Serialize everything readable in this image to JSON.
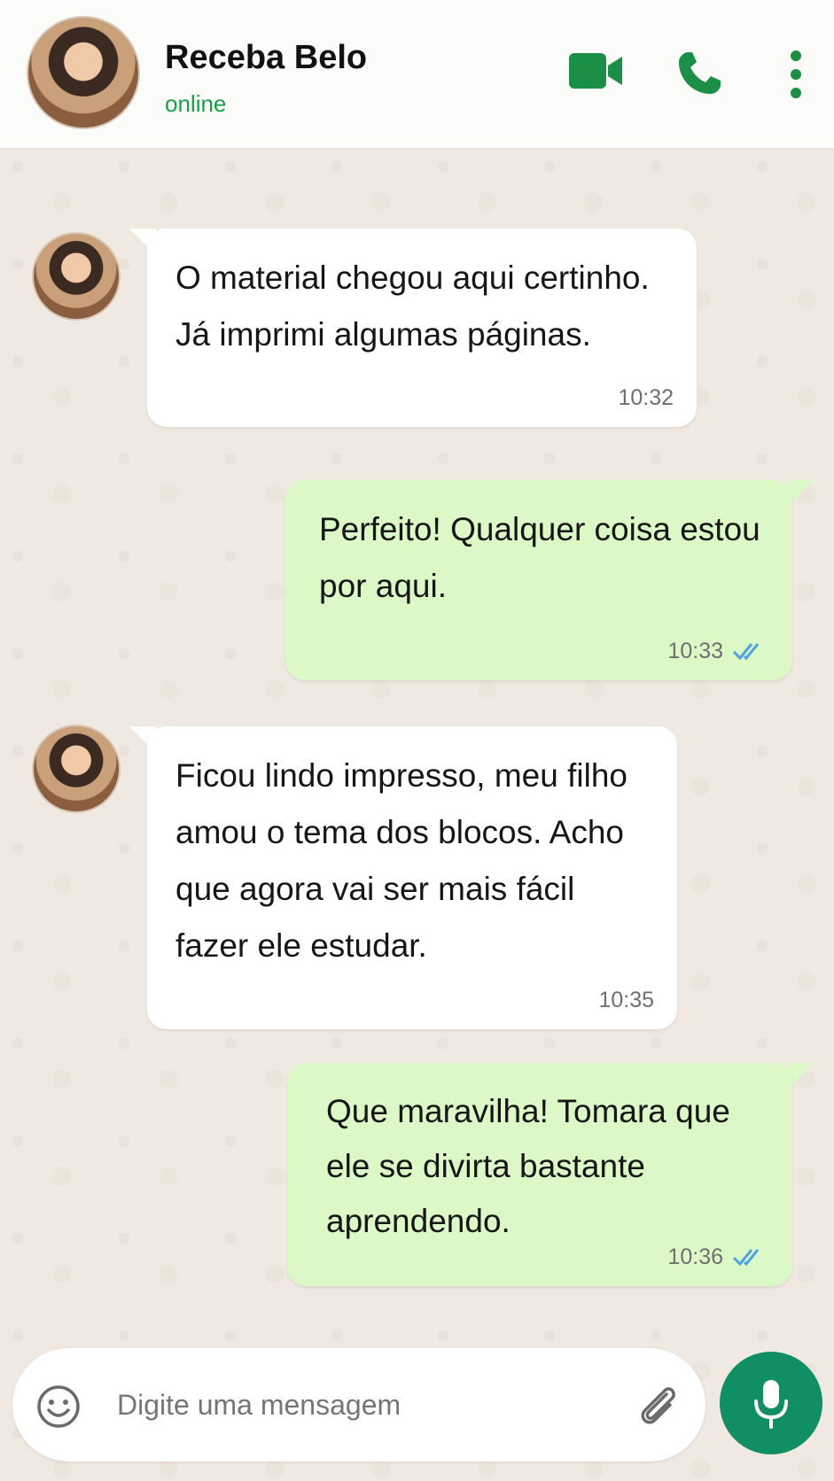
{
  "header": {
    "contact_name": "Receba Belo",
    "status": "online",
    "icons": [
      "video-call-icon",
      "voice-call-icon",
      "more-options-icon"
    ]
  },
  "messages": [
    {
      "direction": "incoming",
      "text": "O material chegou aqui certinho.\nJá imprimi algumas páginas.",
      "time": "10:32"
    },
    {
      "direction": "outgoing",
      "text": "Perfeito! Qualquer coisa estou\npor aqui.",
      "time": "10:33",
      "read": true
    },
    {
      "direction": "incoming",
      "text": "Ficou lindo impresso, meu filho\namou o tema dos blocos. Acho\nque agora vai ser mais fácil\nfazer ele estudar.",
      "time": "10:35"
    },
    {
      "direction": "outgoing",
      "text": "Que maravilha! Tomara que\nele se divirta bastante\naprendendo.",
      "time": "10:36",
      "read": true
    }
  ],
  "composer": {
    "placeholder": "Digite uma mensagem",
    "icons": [
      "emoji-icon",
      "attach-icon",
      "microphone-icon"
    ]
  },
  "colors": {
    "accent_green": "#1e9e4a",
    "icon_green": "#1a8f45",
    "mic_button": "#0f8f63",
    "outgoing_bubble": "#dcf8c6",
    "incoming_bubble": "#ffffff",
    "read_ticks": "#4fa3e0",
    "wallpaper": "#f0e9e1"
  }
}
